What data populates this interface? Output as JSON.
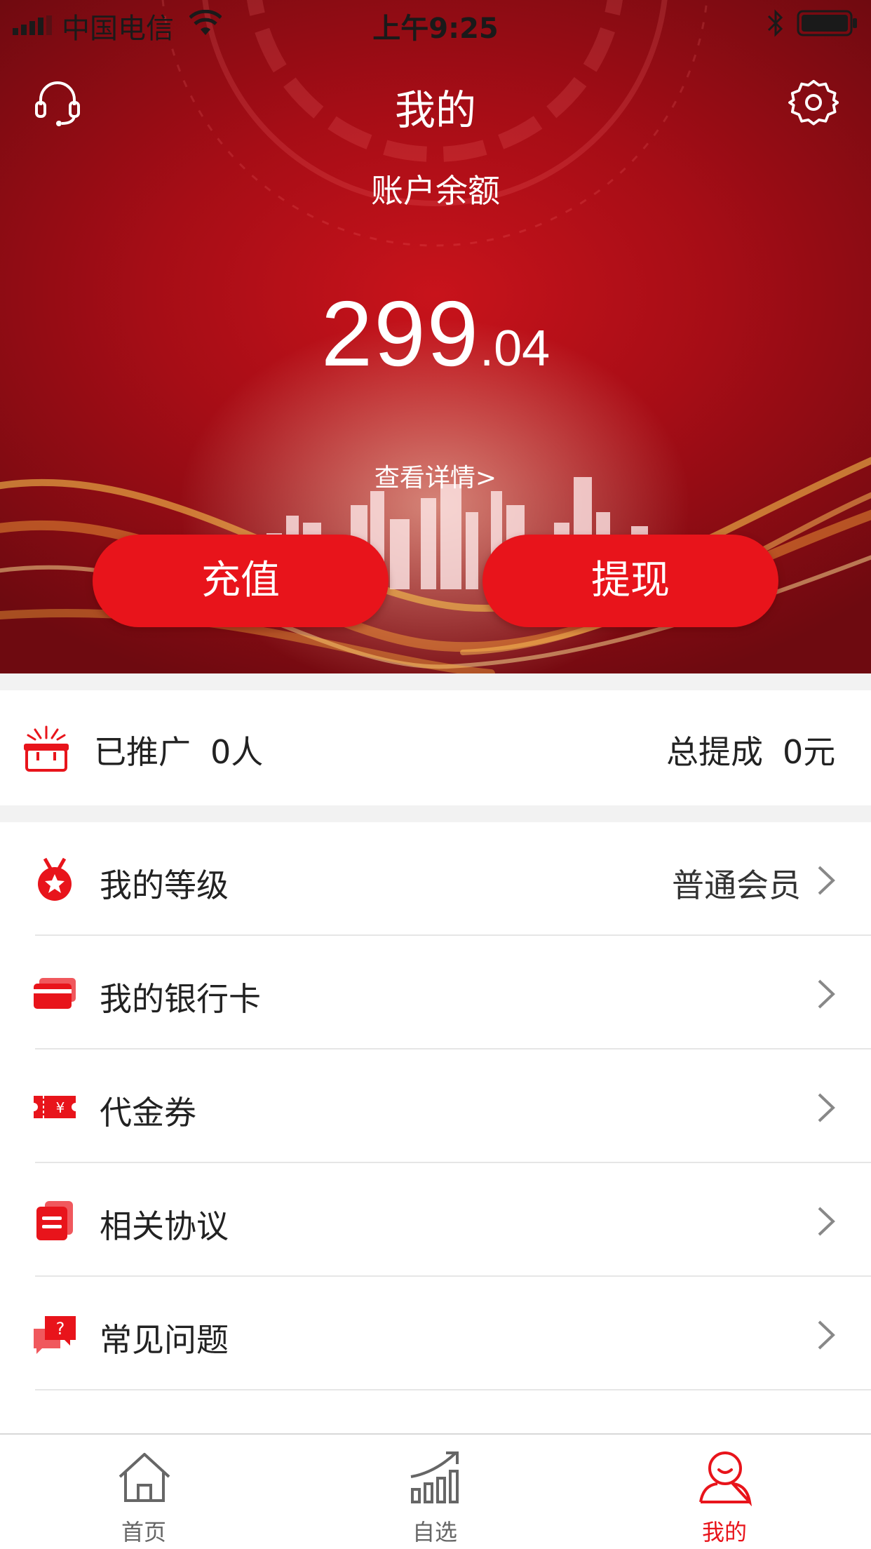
{
  "status_bar": {
    "carrier": "中国电信",
    "time": "上午9:25"
  },
  "header": {
    "title": "我的",
    "left_icon": "headset-icon",
    "right_icon": "gear-icon"
  },
  "account": {
    "balance_label": "账户余额",
    "balance_integer": "299",
    "balance_decimal": ".04",
    "detail_link": "查看详情>",
    "recharge_label": "充值",
    "withdraw_label": "提现"
  },
  "promotion": {
    "label": "已推广",
    "count": "0人",
    "commission_label": "总提成",
    "commission_value": "0元",
    "icon": "gift-sparkle-icon"
  },
  "menu": {
    "items": [
      {
        "label": "我的等级",
        "value": "普通会员",
        "icon": "medal-icon"
      },
      {
        "label": "我的银行卡",
        "value": "",
        "icon": "bank-card-icon"
      },
      {
        "label": "代金券",
        "value": "",
        "icon": "voucher-icon"
      },
      {
        "label": "相关协议",
        "value": "",
        "icon": "agreement-icon"
      },
      {
        "label": "常见问题",
        "value": "",
        "icon": "faq-icon"
      }
    ]
  },
  "tabbar": {
    "tabs": [
      {
        "label": "首页",
        "icon": "home-icon",
        "active": false
      },
      {
        "label": "自选",
        "icon": "trend-chart-icon",
        "active": false
      },
      {
        "label": "我的",
        "icon": "user-icon",
        "active": true
      }
    ]
  },
  "colors": {
    "accent": "#e8141b",
    "hero_dark": "#6e0a10",
    "hero_mid": "#c8131b"
  }
}
